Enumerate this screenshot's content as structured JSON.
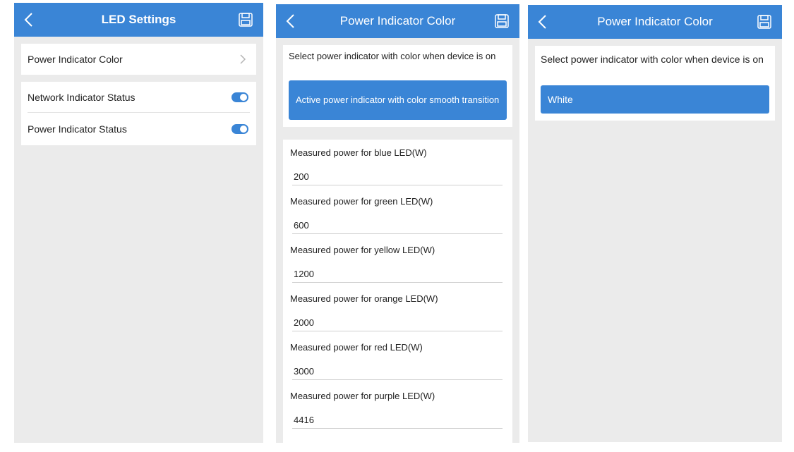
{
  "screen1": {
    "title": "LED Settings",
    "rows": [
      {
        "label": "Power Indicator Color"
      },
      {
        "label": "Network Indicator Status",
        "toggle": true
      },
      {
        "label": "Power Indicator Status",
        "toggle": true
      }
    ]
  },
  "screen2": {
    "title": "Power Indicator Color",
    "prompt": "Select power indicator with color when device is on",
    "selected_option": "Active power indicator with color smooth transition",
    "fields": [
      {
        "label": "Measured power for blue LED(W)",
        "value": "200"
      },
      {
        "label": "Measured power for green LED(W)",
        "value": "600"
      },
      {
        "label": "Measured power for yellow LED(W)",
        "value": "1200"
      },
      {
        "label": "Measured power for orange LED(W)",
        "value": "2000"
      },
      {
        "label": "Measured power for red LED(W)",
        "value": "3000"
      },
      {
        "label": "Measured power for purple LED(W)",
        "value": "4416"
      }
    ]
  },
  "screen3": {
    "title": "Power Indicator Color",
    "prompt": "Select power indicator with color when device is on",
    "selected_option": "White"
  },
  "icons": {
    "back": "chevron-left-icon",
    "save": "save-icon",
    "chevron": "chevron-right-icon"
  },
  "colors": {
    "accent": "#3a85d6",
    "background": "#ebebeb",
    "card": "#ffffff"
  }
}
